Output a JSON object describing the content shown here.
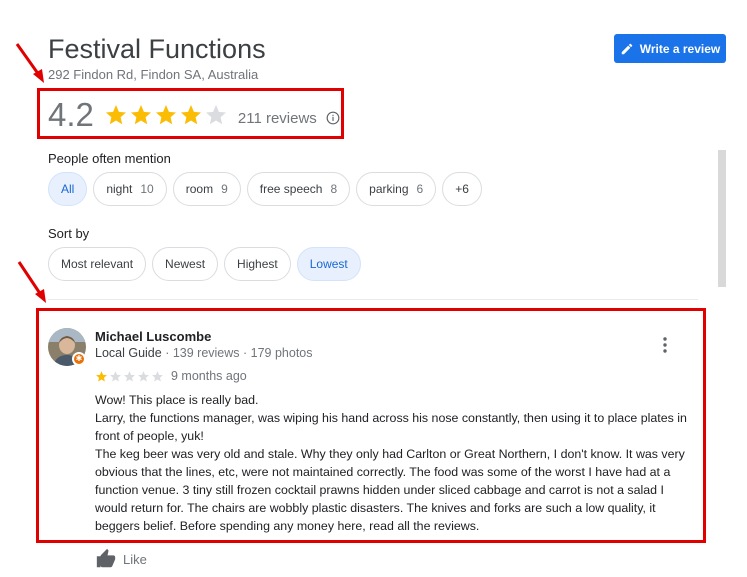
{
  "place": {
    "title": "Festival Functions",
    "address": "292 Findon Rd, Findon SA, Australia",
    "write_review_label": "Write a review"
  },
  "rating": {
    "value": "4.2",
    "stars_filled": 4,
    "stars_total": 5,
    "reviews_count": "211 reviews"
  },
  "mentions": {
    "label": "People often mention",
    "chips": [
      {
        "label": "All",
        "count": "",
        "active": true
      },
      {
        "label": "night",
        "count": "10",
        "active": false
      },
      {
        "label": "room",
        "count": "9",
        "active": false
      },
      {
        "label": "free speech",
        "count": "8",
        "active": false
      },
      {
        "label": "parking",
        "count": "6",
        "active": false
      },
      {
        "label": "+6",
        "count": "",
        "active": false
      }
    ]
  },
  "sort": {
    "label": "Sort by",
    "options": [
      {
        "label": "Most relevant",
        "active": false
      },
      {
        "label": "Newest",
        "active": false
      },
      {
        "label": "Highest",
        "active": false
      },
      {
        "label": "Lowest",
        "active": true
      }
    ]
  },
  "review": {
    "name": "Michael Luscombe",
    "guide": "Local Guide",
    "reviews": "139 reviews",
    "photos": "179 photos",
    "separator": " · ",
    "stars_filled": 1,
    "age": "9 months ago",
    "lines": [
      "Wow! This place is really bad.",
      "Larry, the functions manager, was wiping his hand across his nose constantly, then using it to place plates in front of people, yuk!",
      "The keg beer was very old and stale. Why they only had Carlton or Great Northern, I don't know. It was very obvious that the lines, etc, were not maintained correctly. The food was some of the worst I have had at a function venue. 3 tiny still frozen cocktail prawns hidden under sliced cabbage and carrot is not a salad I would return for. The chairs are wobbly plastic disasters. The knives and forks are such a low quality, it beggers belief. Before spending any money here, read all the reviews."
    ],
    "like_label": "Like"
  },
  "colors": {
    "star": "#fbbc04",
    "star_empty": "#dadce0",
    "accent": "#1a73e8",
    "highlight": "#e00000"
  }
}
